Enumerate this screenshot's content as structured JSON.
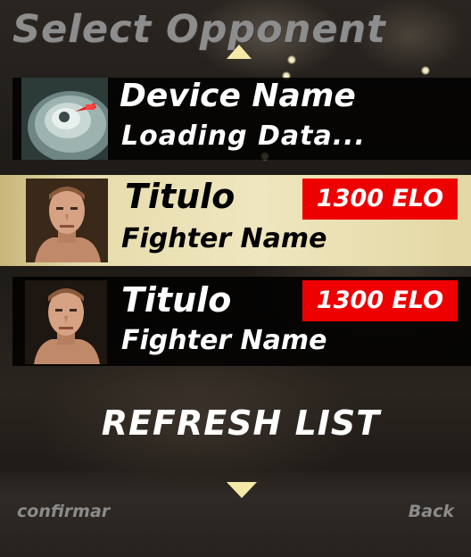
{
  "screen": {
    "title": "Select Opponent",
    "accent_color": "#f4e9a6",
    "elo_badge_color": "#ee0000",
    "selected_row_color": "#e6dcac"
  },
  "device": {
    "name": "Device Name",
    "status": "Loading Data...",
    "icon": "device-icon"
  },
  "opponents": [
    {
      "title": "Titulo",
      "fighter_name": "Fighter Name",
      "elo": "1300 ELO",
      "selected": true,
      "portrait": "fighter-portrait"
    },
    {
      "title": "Titulo",
      "fighter_name": "Fighter Name",
      "elo": "1300 ELO",
      "selected": false,
      "portrait": "fighter-portrait"
    }
  ],
  "actions": {
    "refresh_label": "REFRESH LIST"
  },
  "softkeys": {
    "left": "confirmar",
    "right": "Back"
  },
  "icons": {
    "scroll_up": "chevron-up-icon",
    "scroll_down": "chevron-down-icon"
  }
}
